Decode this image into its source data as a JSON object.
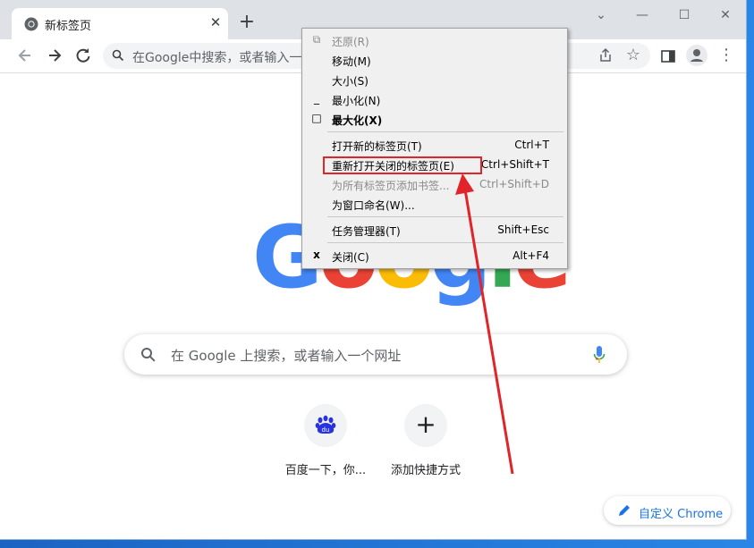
{
  "tab": {
    "title": "新标签页",
    "close": "✕"
  },
  "newtab": "+",
  "window_controls": {
    "dropdown": "⌄",
    "minimize": "—",
    "maximize": "☐",
    "close": "✕"
  },
  "omnibox": {
    "placeholder": "在Google中搜索，或者输入一"
  },
  "logo": {
    "letters": [
      "G",
      "o",
      "o",
      "g",
      "l",
      "e"
    ],
    "colors": [
      "#4285f4",
      "#ea4335",
      "#fbbc05",
      "#4285f4",
      "#34a853",
      "#ea4335"
    ]
  },
  "search": {
    "placeholder": "在 Google 上搜索，或者输入一个网址"
  },
  "tiles": [
    {
      "label": "百度一下，你...",
      "icon": "baidu-icon"
    },
    {
      "label": "添加快捷方式",
      "icon": "plus-icon",
      "glyph": "+"
    }
  ],
  "customize": {
    "label": "自定义 Chrome"
  },
  "context_menu": {
    "items": [
      {
        "label": "还原(R)",
        "shortcut": "",
        "disabled": true,
        "glyph": "⧉"
      },
      {
        "label": "移动(M)",
        "shortcut": "",
        "disabled": false,
        "glyph": ""
      },
      {
        "label": "大小(S)",
        "shortcut": "",
        "disabled": false,
        "glyph": ""
      },
      {
        "label": "最小化(N)",
        "shortcut": "",
        "disabled": false,
        "glyph": "_"
      },
      {
        "label": "最大化(X)",
        "shortcut": "",
        "disabled": false,
        "glyph": "□",
        "bold": true
      },
      {
        "label": "打开新的标签页(T)",
        "shortcut": "Ctrl+T",
        "disabled": false,
        "glyph": ""
      },
      {
        "label": "重新打开关闭的标签页(E)",
        "shortcut": "Ctrl+Shift+T",
        "disabled": false,
        "glyph": "",
        "highlighted": true
      },
      {
        "label": "为所有标签页添加书签...",
        "shortcut": "Ctrl+Shift+D",
        "disabled": true,
        "glyph": ""
      },
      {
        "label": "为窗口命名(W)...",
        "shortcut": "",
        "disabled": false,
        "glyph": ""
      },
      {
        "label": "任务管理器(T)",
        "shortcut": "Shift+Esc",
        "disabled": false,
        "glyph": ""
      },
      {
        "label": "关闭(C)",
        "shortcut": "Alt+F4",
        "disabled": false,
        "glyph": "x"
      }
    ]
  },
  "colors": {
    "annotation": "#e0242a",
    "accent": "#1a73e8"
  }
}
